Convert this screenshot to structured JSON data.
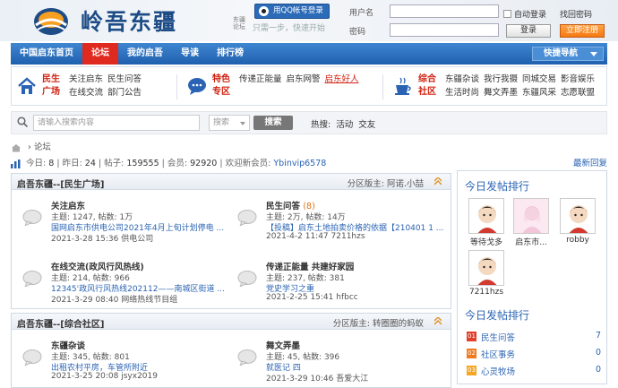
{
  "header": {
    "site_title": "岭吾东疆",
    "logo_small_text": "东疆论坛",
    "slogan": "只需一步，快速开始",
    "qq_login": "用QQ帐号登录",
    "username_label": "用户名",
    "password_label": "密码",
    "auto_login": "自动登录",
    "forgot_password": "找回密码",
    "login_button": "登录",
    "register_button": "立即注册"
  },
  "nav": {
    "items": [
      "中国启东首页",
      "论坛",
      "我的启吾",
      "导读",
      "排行榜"
    ],
    "active_index": 1,
    "quick_nav": "快捷导航"
  },
  "categories": [
    {
      "name": "民生广场",
      "row1": [
        "关注启东",
        "民生问答"
      ],
      "row2": [
        "在线交流",
        "部门公告"
      ]
    },
    {
      "name": "特色专区",
      "row1": [
        "传递正能量",
        "启东网警",
        "启东好人"
      ],
      "row2": []
    },
    {
      "name": "综合社区",
      "row1": [
        "东疆杂谈",
        "我行我摄",
        "同城交易",
        "影音娱乐"
      ],
      "row2": [
        "生活时尚",
        "舞文弄墨",
        "东疆风采",
        "志愿联盟"
      ]
    }
  ],
  "search": {
    "placeholder": "请输入搜索内容",
    "type": "搜索",
    "button": "搜索",
    "hot_label": "热搜:",
    "hot_items": [
      "活动",
      "交友"
    ]
  },
  "breadcrumb": {
    "current": "论坛"
  },
  "stats": {
    "today_label": "今日:",
    "today": "8",
    "yesterday_label": "昨日:",
    "yesterday": "24",
    "posts_label": "帖子:",
    "posts": "159555",
    "members_label": "会员:",
    "members": "92920",
    "welcome_label": "欢迎新会员:",
    "new_member": "Ybinvip6578",
    "latest_reply": "最新回复"
  },
  "sections": [
    {
      "title": "启吾东疆--[民生广场]",
      "moderator": "分区版主: 阿诺.小喆",
      "forums": [
        {
          "name": "关注启东",
          "count": "",
          "stats": "主题: 1247, 帖数: 1万",
          "last_title": "国网启东市供电公司2021年4月上旬计划停电 ...",
          "last_time": "2021-3-28 15:36 供电公司"
        },
        {
          "name": "民生问答",
          "count": "(8)",
          "stats": "主题: 2万, 帖数: 14万",
          "last_title": "【投稿】启东土地拍卖价格的依据【210401 1 ...",
          "last_time": "2021-4-2 11:47 7211hzs"
        },
        {
          "name": "在线交流(政风行风热线)",
          "count": "",
          "stats": "主题: 214, 帖数: 966",
          "last_title": "12345'政风行风热线202112——南城区街道 ...",
          "last_time": "2021-3-29 08:40 网络热线节目组"
        },
        {
          "name": "传递正能量 共建好家园",
          "count": "",
          "stats": "主题: 237, 帖数: 381",
          "last_title": "党史学习之重",
          "last_time": "2021-2-25 15:41 hfbcc"
        }
      ]
    },
    {
      "title": "启吾东疆--[综合社区]",
      "moderator": "分区版主: 转圈圈的蚂蚁",
      "forums": [
        {
          "name": "东疆杂谈",
          "count": "",
          "stats": "主题: 345, 帖数: 801",
          "last_title": "出租农村平房，车管所附近",
          "last_time": "2021-3-25 20:08 jsyx2019"
        },
        {
          "name": "舞文弄墨",
          "count": "",
          "stats": "主题: 45, 帖数: 396",
          "last_title": "就医记 四",
          "last_time": "2021-3-29 10:46 吾爱大江"
        }
      ]
    }
  ],
  "sidebar": {
    "title1": "今日发帖排行",
    "users": [
      {
        "name": "等待戈多"
      },
      {
        "name": "启东市..."
      },
      {
        "name": "robby"
      },
      {
        "name": "7211hzs"
      }
    ],
    "title2": "今日发帖排行",
    "ranks": [
      {
        "no": "01",
        "name": "民生问答",
        "value": "7"
      },
      {
        "no": "02",
        "name": "社区事务",
        "value": "0"
      },
      {
        "no": "03",
        "name": "心灵牧场",
        "value": "0"
      }
    ]
  }
}
